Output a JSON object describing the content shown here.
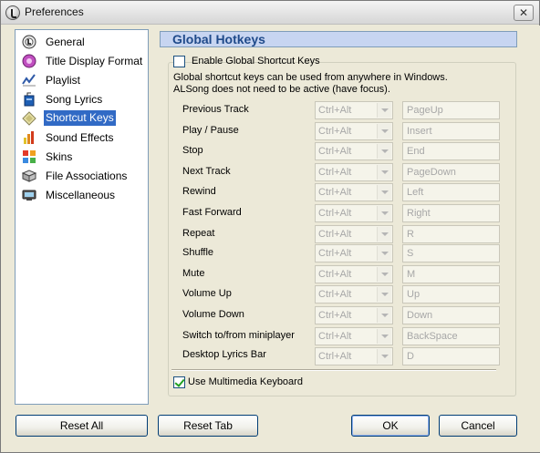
{
  "window": {
    "title": "Preferences",
    "close_glyph": "✕"
  },
  "sidebar": {
    "items": [
      {
        "label": "General",
        "icon": "general-icon",
        "selected": false
      },
      {
        "label": "Title Display Format",
        "icon": "title-display-icon",
        "selected": false
      },
      {
        "label": "Playlist",
        "icon": "playlist-icon",
        "selected": false
      },
      {
        "label": "Song Lyrics",
        "icon": "lyrics-icon",
        "selected": false
      },
      {
        "label": "Shortcut Keys",
        "icon": "shortcut-keys-icon",
        "selected": true
      },
      {
        "label": "Sound Effects",
        "icon": "sound-effects-icon",
        "selected": false
      },
      {
        "label": "Skins",
        "icon": "skins-icon",
        "selected": false
      },
      {
        "label": "File Associations",
        "icon": "file-associations-icon",
        "selected": false
      },
      {
        "label": "Miscellaneous",
        "icon": "miscellaneous-icon",
        "selected": false
      }
    ]
  },
  "panel": {
    "title": "Global Hotkeys",
    "enable_label": "Enable Global Shortcut Keys",
    "enable_checked": false,
    "desc_line1": "Global shortcut keys can be used from anywhere in Windows.",
    "desc_line2": "ALSong does not need to be active (have focus).",
    "hotkeys": [
      {
        "action": "Previous Track",
        "modifier": "Ctrl+Alt",
        "key": "PageUp"
      },
      {
        "action": "Play / Pause",
        "modifier": "Ctrl+Alt",
        "key": "Insert"
      },
      {
        "action": "Stop",
        "modifier": "Ctrl+Alt",
        "key": "End"
      },
      {
        "action": "Next Track",
        "modifier": "Ctrl+Alt",
        "key": "PageDown"
      },
      {
        "action": "Rewind",
        "modifier": "Ctrl+Alt",
        "key": "Left"
      },
      {
        "action": "Fast Forward",
        "modifier": "Ctrl+Alt",
        "key": "Right"
      },
      {
        "action": "Repeat",
        "modifier": "Ctrl+Alt",
        "key": "R"
      },
      {
        "action": "Shuffle",
        "modifier": "Ctrl+Alt",
        "key": "S"
      },
      {
        "action": "Mute",
        "modifier": "Ctrl+Alt",
        "key": "M"
      },
      {
        "action": "Volume Up",
        "modifier": "Ctrl+Alt",
        "key": "Up"
      },
      {
        "action": "Volume Down",
        "modifier": "Ctrl+Alt",
        "key": "Down"
      },
      {
        "action": "Switch to/from miniplayer",
        "modifier": "Ctrl+Alt",
        "key": "BackSpace"
      },
      {
        "action": "Desktop Lyrics Bar",
        "modifier": "Ctrl+Alt",
        "key": "D"
      }
    ],
    "multimedia_label": "Use Multimedia Keyboard",
    "multimedia_checked": true
  },
  "buttons": {
    "reset_all": "Reset All",
    "reset_tab": "Reset Tab",
    "ok": "OK",
    "cancel": "Cancel"
  },
  "colors": {
    "selection": "#316ac5",
    "header_bg": "#c7d5f1",
    "header_text": "#1f4a8a",
    "disabled_text": "#a7a7a7"
  }
}
